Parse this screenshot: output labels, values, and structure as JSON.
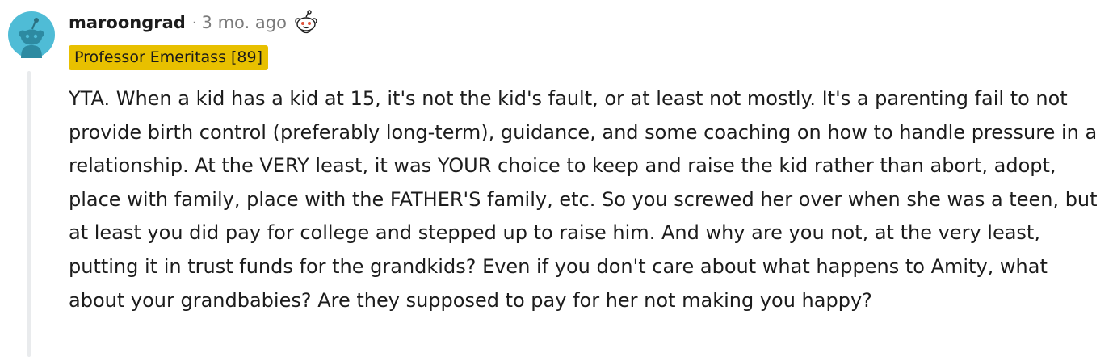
{
  "comment": {
    "username": "maroongrad",
    "separator": "·",
    "time_ago": "3 mo. ago",
    "flair": "Professor Emeritass [89]",
    "avatar_icon": "reddit-snoo-avatar-icon",
    "award_icon": "snoo-award-icon",
    "avatar_color": "#4fbcd6",
    "flair_color": "#e8c000",
    "body": "YTA. When a kid has a kid at 15, it's not the kid's fault, or at least not mostly. It's a parenting fail to not provide birth control (preferably long-term), guidance, and some coaching on how to handle pressure in a relationship. At the VERY least, it was YOUR choice to keep and raise the kid rather than abort, adopt, place with family, place with the FATHER'S family, etc. So you screwed her over when she was a teen, but at least you did pay for college and stepped up to raise him. And why are you not, at the very least, putting it in trust funds for the grandkids? Even if you don't care about what happens to Amity, what about your grandbabies? Are they supposed to pay for her not making you happy?"
  }
}
